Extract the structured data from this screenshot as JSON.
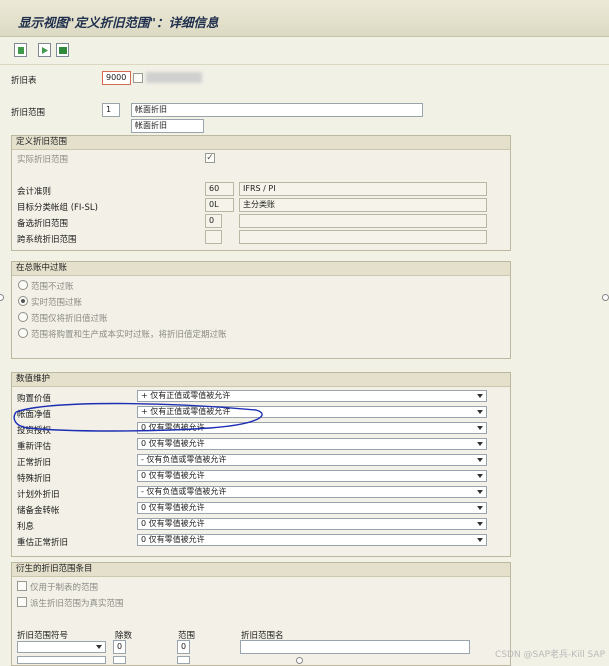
{
  "title": "显示视图\"定义折旧范围\"：详细信息",
  "toolbar": {
    "icons": [
      "new-entry-icon",
      "next-entry-icon",
      "export-icon"
    ]
  },
  "header": {
    "chart_of_dep_label": "折旧表",
    "chart_of_dep_value": "9000",
    "dep_area_label": "折旧范围",
    "dep_area_value": "1",
    "dep_area_name": "帐面折旧",
    "dep_area_short": "帐面折旧"
  },
  "define_area": {
    "title": "定义折旧范围",
    "real_area_label": "实际折旧范围",
    "real_area_checked": "✓",
    "accounting_label": "会计准则",
    "accounting_value": "60",
    "accounting_text": "IFRS / PI",
    "ledger_label": "目标分类帐组 (FI-SL)",
    "ledger_value": "0L",
    "ledger_text": "主分类账",
    "alt_area_label": "备选折旧范围",
    "alt_area_value": "0",
    "cross_area_label": "跨系统折旧范围"
  },
  "posting": {
    "title": "在总账中过账",
    "options": [
      "范围不过账",
      "实时范围过账",
      "范围仅将折旧值过账",
      "范围将购置和生产成本实时过账，将折旧值定期过账"
    ],
    "selected_index": 1
  },
  "value_maint": {
    "title": "数值维护",
    "rows": [
      {
        "label": "购置价值",
        "value": "+ 仅有正值或零值被允许"
      },
      {
        "label": "帐面净值",
        "value": "+ 仅有正值或零值被允许"
      },
      {
        "label": "投资授权",
        "value": "0 仅有零值被允许"
      },
      {
        "label": "重新评估",
        "value": "0 仅有零值被允许"
      },
      {
        "label": "正常折旧",
        "value": "- 仅有负值或零值被允许"
      },
      {
        "label": "特殊折旧",
        "value": "0 仅有零值被允许"
      },
      {
        "label": "计划外折旧",
        "value": "- 仅有负值或零值被允许"
      },
      {
        "label": "储备金转帐",
        "value": "0 仅有零值被允许"
      },
      {
        "label": "利息",
        "value": "0 仅有零值被允许"
      },
      {
        "label": "重估正常折旧",
        "value": "0 仅有零值被允许"
      }
    ]
  },
  "derived": {
    "title": "衍生的折旧范围条目",
    "opt1": "仅用于制表的范围",
    "opt2": "派生折旧范围为真实范围",
    "col_symbol": "折旧范围符号",
    "col_divisor": "除数",
    "col_area": "范围",
    "col_area_name": "折旧范围名",
    "divisor_value": "0",
    "area_value": "0"
  },
  "watermark": "CSDN @SAP老兵-Kill SAP"
}
